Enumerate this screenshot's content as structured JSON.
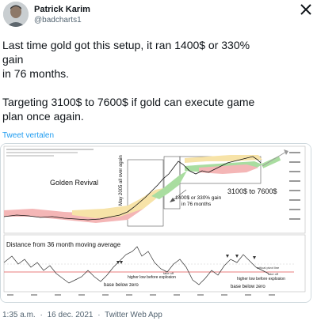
{
  "author": {
    "name": "Patrick Karim",
    "handle": "@badcharts1"
  },
  "tweet": {
    "text": "Last time gold got this setup, it ran 1400$ or 330%\ngain\nin 76 months.\n\nTargeting 3100$ to 7600$ if gold can execute game\nplan once again.",
    "translate_label": "Tweet vertalen"
  },
  "chart_image": {
    "label_golden_revival": "Golden Revival",
    "label_may2005": "May 2005 all over again",
    "label_gain_line1": "1400$ or 330% gain",
    "label_gain_line2": "in 76 months",
    "label_target": "3100$ to 7600$",
    "label_distance": "Distance from 36 month moving average",
    "label_higher_low": "higher low before explosion",
    "label_base_below_zero": "base below zero",
    "label_critical_pivot": "critical pivot line",
    "label_take_off": "take off"
  },
  "footer": {
    "time": "1:35 a.m.",
    "sep": "·",
    "date": "16 dec. 2021",
    "sep2": "·",
    "source": "Twitter Web App"
  },
  "colors": {
    "link": "#1d9bf0",
    "muted": "#536471",
    "red_band": "#f4b6b6",
    "green_band": "#a9dda0",
    "yellow_band": "#f7e3a8",
    "pivot_line": "#e05050"
  },
  "icons": {
    "close": "x-icon",
    "avatar": "avatar-photo"
  }
}
